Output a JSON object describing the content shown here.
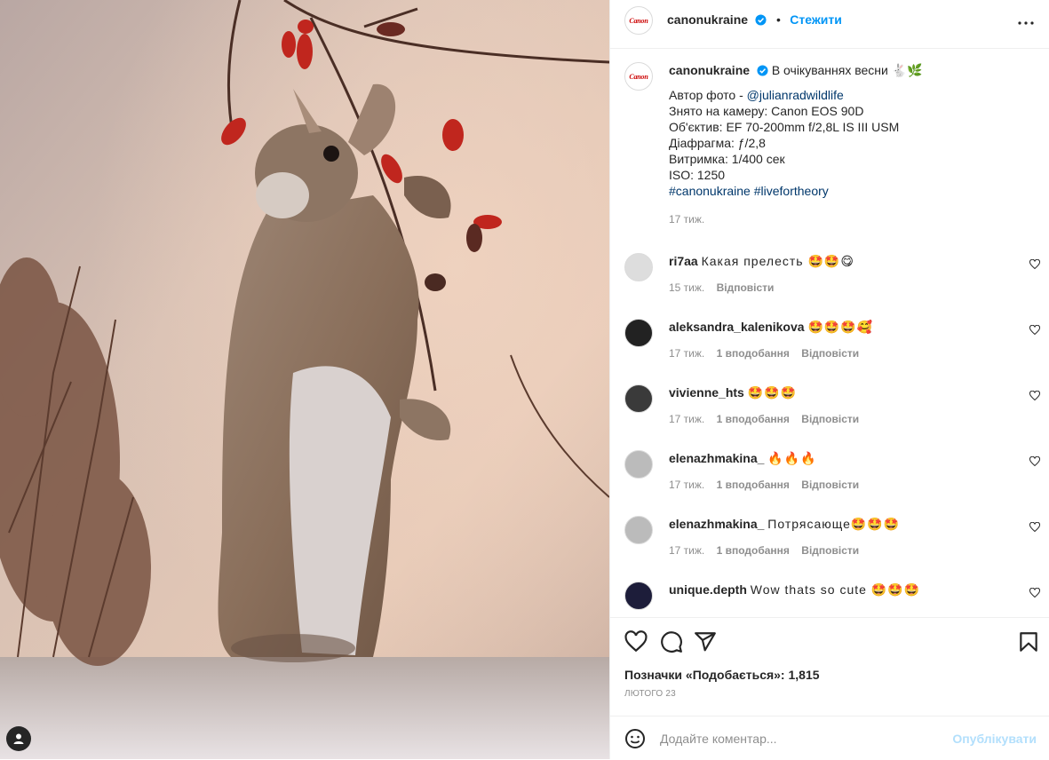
{
  "post": {
    "username": "canonukraine",
    "avatar_text": "Canon",
    "follow_label": "Стежити",
    "dot": "•",
    "caption_title": "В очікуваннях весни 🐇🌿",
    "caption_credit_prefix": "Автор фото - ",
    "caption_credit_link": "@julianradwildlife",
    "caption_lines": "Знято на камеру: Canon EOS 90D\nОб'єктив: EF 70-200mm f/2,8L IS III USM\nДіафрагма: ƒ/2,8\nВитримка: 1/400 сек\nISO: 1250",
    "caption_hashtags": "#canonukraine #livefortheory",
    "caption_age": "17 тиж."
  },
  "comments": [
    {
      "user": "ri7aa",
      "text": "Какая прелесть 🤩🤩😋",
      "age": "15 тиж.",
      "likes": "",
      "reply": "Відповісти"
    },
    {
      "user": "aleksandra_kalenikova",
      "text": "🤩🤩🤩🥰",
      "age": "17 тиж.",
      "likes": "1 вподобання",
      "reply": "Відповісти"
    },
    {
      "user": "vivienne_hts",
      "text": "🤩🤩🤩",
      "age": "17 тиж.",
      "likes": "1 вподобання",
      "reply": "Відповісти"
    },
    {
      "user": "elenazhmakina_",
      "text": "🔥🔥🔥",
      "age": "17 тиж.",
      "likes": "1 вподобання",
      "reply": "Відповісти"
    },
    {
      "user": "elenazhmakina_",
      "text": "Потрясающе🤩🤩🤩",
      "age": "17 тиж.",
      "likes": "1 вподобання",
      "reply": "Відповісти"
    },
    {
      "user": "unique.depth",
      "text": "Wow thats so cute 🤩🤩🤩",
      "age": "",
      "likes": "",
      "reply": ""
    }
  ],
  "actions": {
    "likes_label": "Позначки «Подобається»: 1,815",
    "date": "ЛЮТОГО 23"
  },
  "composer": {
    "placeholder": "Додайте коментар...",
    "post_label": "Опублікувати"
  },
  "icons": {
    "verified": "verified-badge-icon",
    "more": "more-options-icon",
    "heart": "heart-icon",
    "comment": "comment-icon",
    "share": "share-icon",
    "save": "bookmark-icon",
    "emoji": "emoji-icon",
    "tag": "user-tag-icon"
  },
  "colors": {
    "accent": "#0095f6",
    "link": "#00376b",
    "brand": "#cc0000",
    "muted": "#8e8e8e"
  }
}
